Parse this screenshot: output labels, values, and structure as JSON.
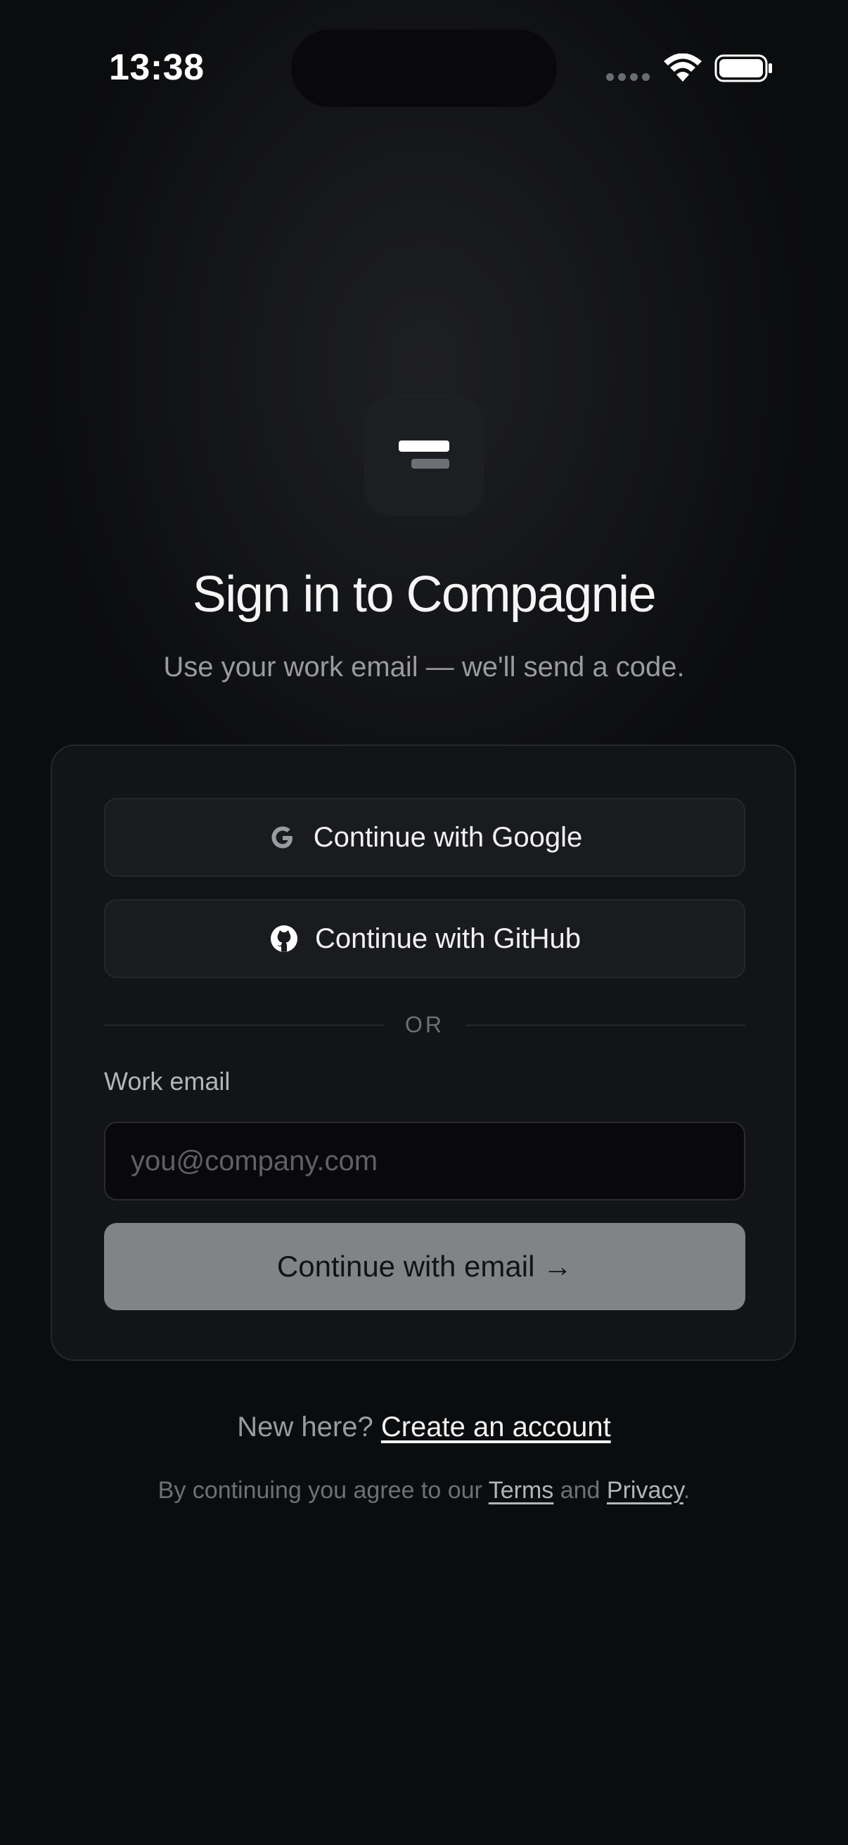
{
  "status_bar": {
    "time": "13:38"
  },
  "brand": {
    "logo_icon": "compagnie-logo-icon"
  },
  "header": {
    "title": "Sign in to Compagnie",
    "subtitle": "Use your work email — we'll send a code."
  },
  "oauth": {
    "google_label": "Continue with Google",
    "google_icon": "google-icon",
    "github_label": "Continue with GitHub",
    "github_icon": "github-icon"
  },
  "divider": {
    "label": "OR"
  },
  "email": {
    "label": "Work email",
    "placeholder": "you@company.com",
    "value": "",
    "submit_label": "Continue with email →"
  },
  "footer": {
    "signup_prompt": "New here?",
    "signup_link": "Create an account",
    "legal_prefix": "By continuing you agree to our",
    "terms_link": "Terms",
    "legal_and": "and",
    "privacy_link": "Privacy",
    "legal_suffix": "."
  },
  "colors": {
    "background": "#0b0c0e",
    "card": "#131417",
    "button_surface": "#1a1b1f",
    "primary_button": "#828385",
    "text_primary": "#f2f2f2",
    "text_muted": "#9a9ba0"
  }
}
